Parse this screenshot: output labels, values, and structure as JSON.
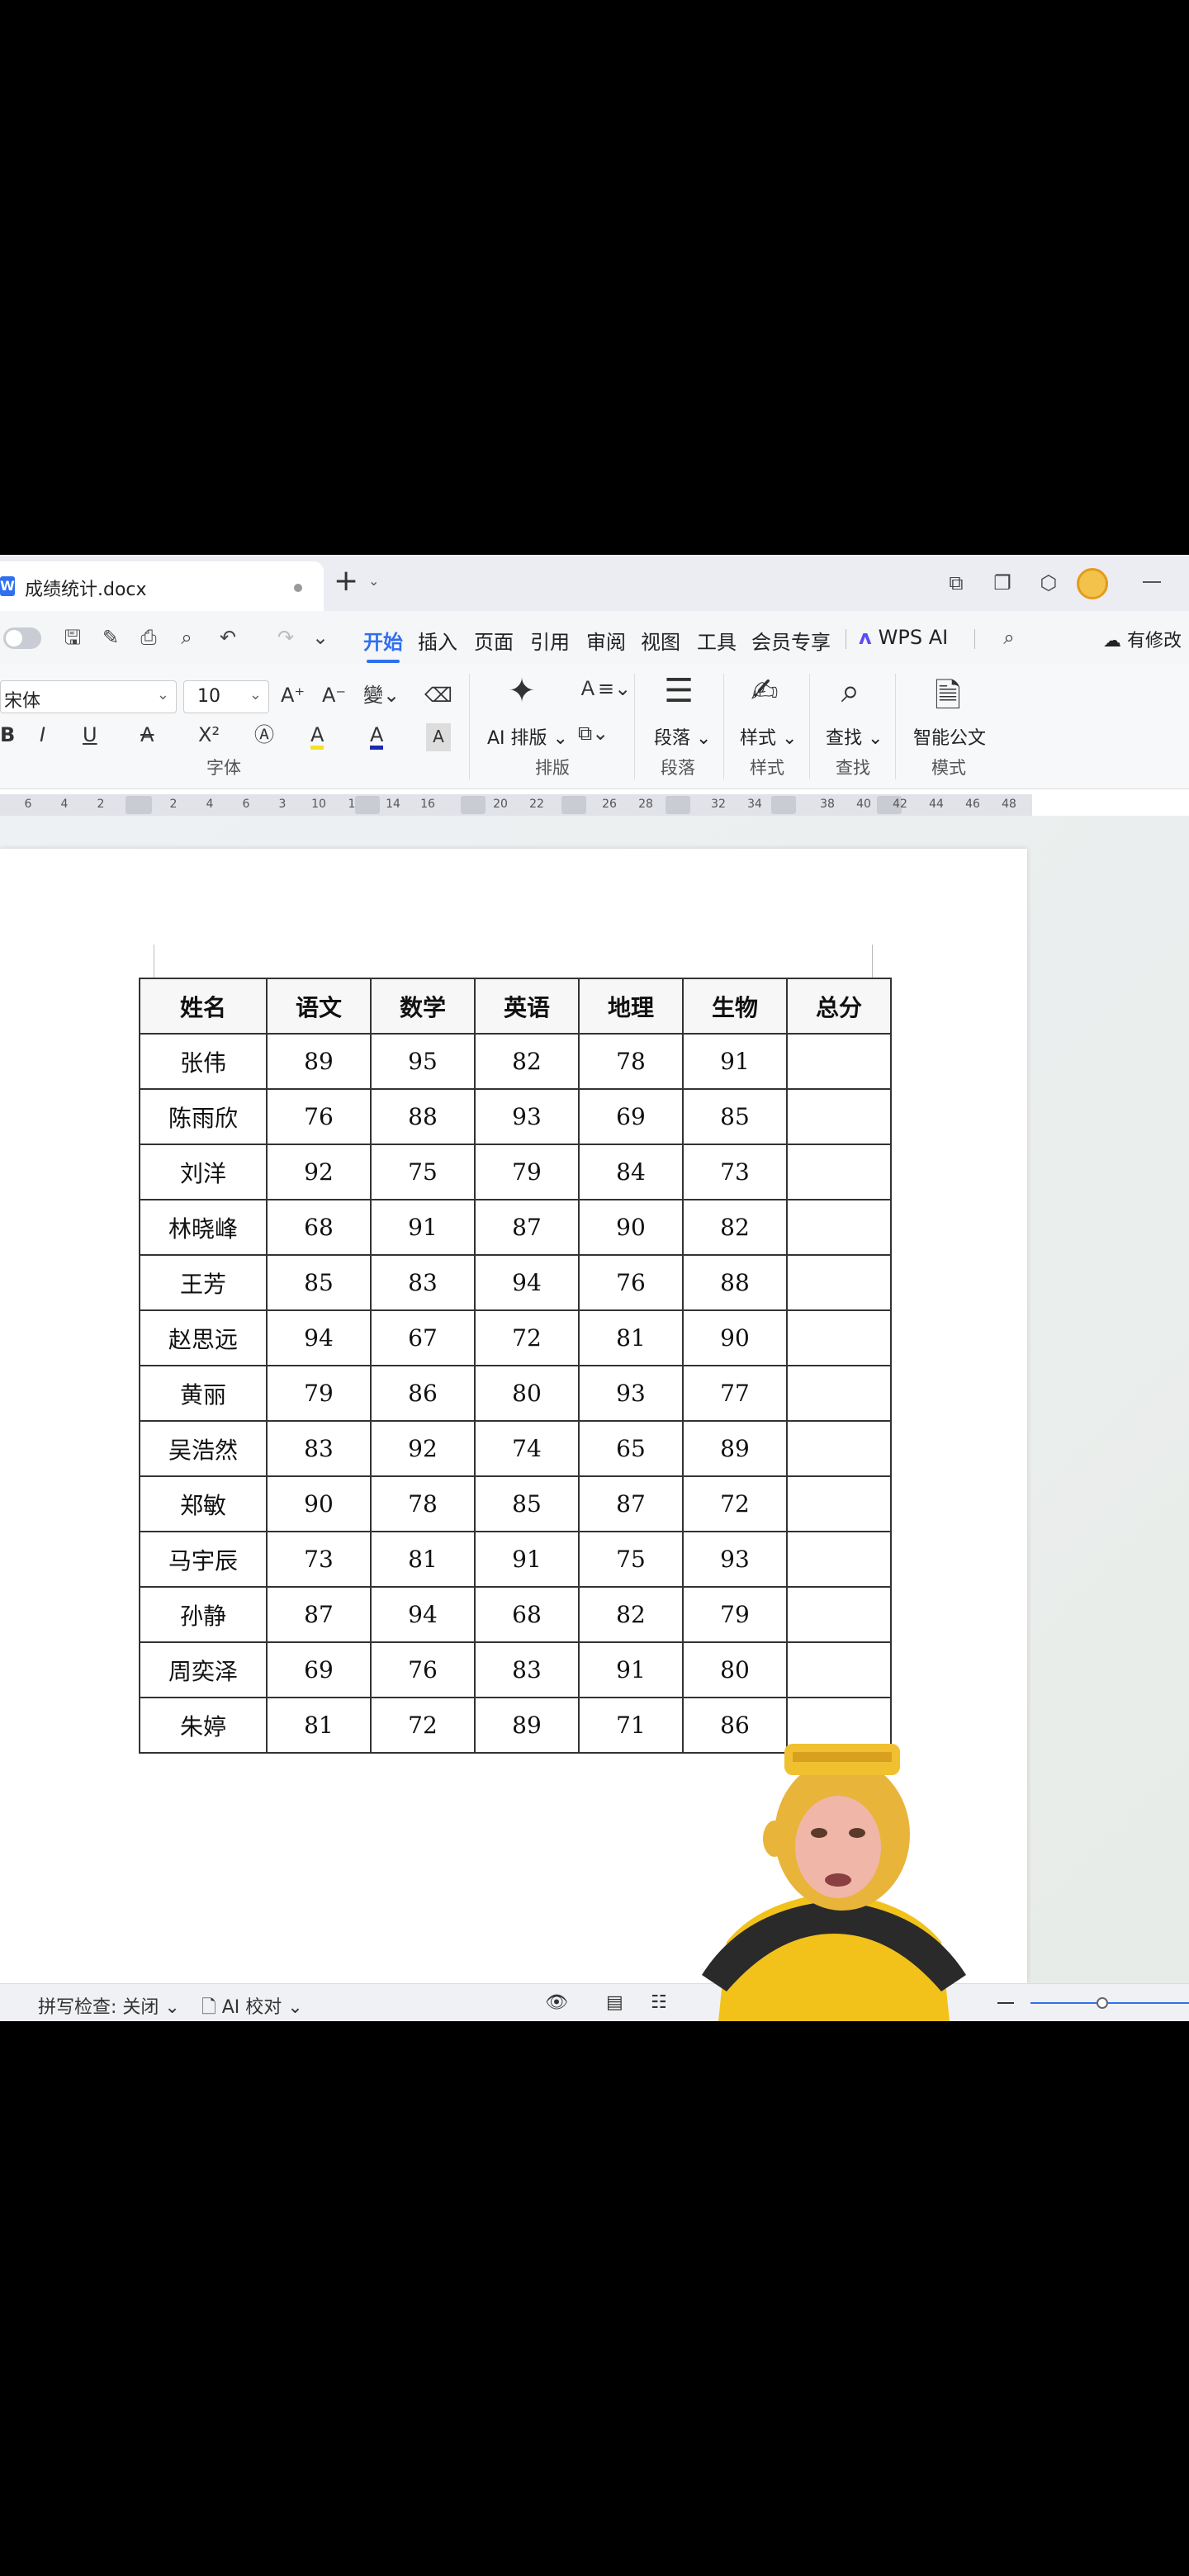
{
  "tabbar": {
    "file_name": "成绩统计.docx",
    "app_letter": "W"
  },
  "menu": {
    "items": [
      "开始",
      "插入",
      "页面",
      "引用",
      "审阅",
      "视图",
      "工具",
      "会员专享"
    ],
    "active": "开始",
    "wps_ai": "WPS AI",
    "modify_label": "有修改"
  },
  "ribbon": {
    "font_name": "宋体",
    "font_size": "10",
    "bold": "B",
    "italic": "I",
    "underline": "U",
    "superscript": "X²",
    "font_color_letter": "A",
    "highlight_letter": "A",
    "layout_label": "AI 排版",
    "paragraph_label": "段落",
    "style_label": "样式",
    "find_label": "查找",
    "smart_doc_label": "智能公文",
    "groups": [
      "字体",
      "排版",
      "段落",
      "样式",
      "查找",
      "模式"
    ]
  },
  "ruler": [
    "6",
    "4",
    "2",
    "2",
    "4",
    "6",
    "3",
    "10",
    "1",
    "14",
    "16",
    "20",
    "22",
    "26",
    "28",
    "32",
    "34",
    "38",
    "40",
    "42",
    "44",
    "46",
    "48"
  ],
  "table": {
    "headers": [
      "姓名",
      "语文",
      "数学",
      "英语",
      "地理",
      "生物",
      "总分"
    ],
    "rows": [
      [
        "张伟",
        "89",
        "95",
        "82",
        "78",
        "91",
        ""
      ],
      [
        "陈雨欣",
        "76",
        "88",
        "93",
        "69",
        "85",
        ""
      ],
      [
        "刘洋",
        "92",
        "75",
        "79",
        "84",
        "73",
        ""
      ],
      [
        "林晓峰",
        "68",
        "91",
        "87",
        "90",
        "82",
        ""
      ],
      [
        "王芳",
        "85",
        "83",
        "94",
        "76",
        "88",
        ""
      ],
      [
        "赵思远",
        "94",
        "67",
        "72",
        "81",
        "90",
        ""
      ],
      [
        "黄丽",
        "79",
        "86",
        "80",
        "93",
        "77",
        ""
      ],
      [
        "吴浩然",
        "83",
        "92",
        "74",
        "65",
        "89",
        ""
      ],
      [
        "郑敏",
        "90",
        "78",
        "85",
        "87",
        "72",
        ""
      ],
      [
        "马宇辰",
        "73",
        "81",
        "91",
        "75",
        "93",
        ""
      ],
      [
        "孙静",
        "87",
        "94",
        "68",
        "82",
        "79",
        ""
      ],
      [
        "周奕泽",
        "69",
        "76",
        "83",
        "91",
        "80",
        ""
      ],
      [
        "朱婷",
        "81",
        "72",
        "89",
        "71",
        "86",
        ""
      ]
    ]
  },
  "statusbar": {
    "spellcheck": "拼写检查: 关闭",
    "ai_proof": "AI 校对"
  },
  "colors": {
    "accent": "#2f6ff0",
    "wps_ai": "#5b4cf5",
    "presenter_yellow": "#f2c21a"
  }
}
